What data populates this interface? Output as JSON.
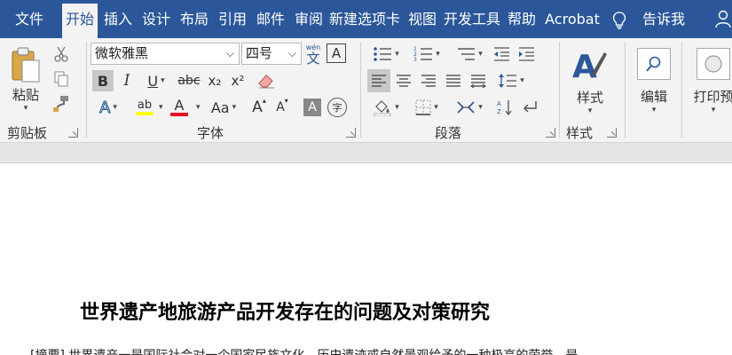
{
  "tabs": [
    "文件",
    "开始",
    "插入",
    "设计",
    "布局",
    "引用",
    "邮件",
    "审阅",
    "新建选项卡",
    "视图",
    "开发工具",
    "帮助",
    "Acrobat"
  ],
  "active_tab": "开始",
  "tell_me": "告诉我",
  "clipboard": {
    "paste_label": "粘贴",
    "group_label": "剪贴板"
  },
  "font": {
    "name": "微软雅黑",
    "size": "四号",
    "phonetic_glyph": "文",
    "border_glyph": "A",
    "bold": "B",
    "italic": "I",
    "underline": "U",
    "strike": "abc",
    "subscript": "x₂",
    "superscript": "x²",
    "text_effects": "A",
    "highlight": "ab",
    "font_color": "A",
    "change_case": "Aa",
    "grow": "A",
    "shrink": "A",
    "shading": "A",
    "enclose": "字",
    "group_label": "字体"
  },
  "paragraph": {
    "group_label": "段落"
  },
  "styles": {
    "label": "样式",
    "group_label": "样式"
  },
  "editing": {
    "label": "编辑"
  },
  "print": {
    "label": "打印预"
  },
  "colors": {
    "tabbar": "#2b579a",
    "ribbon": "#f3f3f3",
    "highlight": "#ffff00",
    "font_color": "#e81123"
  },
  "document": {
    "title": "世界遗产地旅游产品开发存在的问题及对策研究",
    "abstract_partial": "[摘要] 世界遗产一是国际社会对一个国家民族文化、历史遗迹或自然景观给予的一种极高的荣誉，是"
  }
}
